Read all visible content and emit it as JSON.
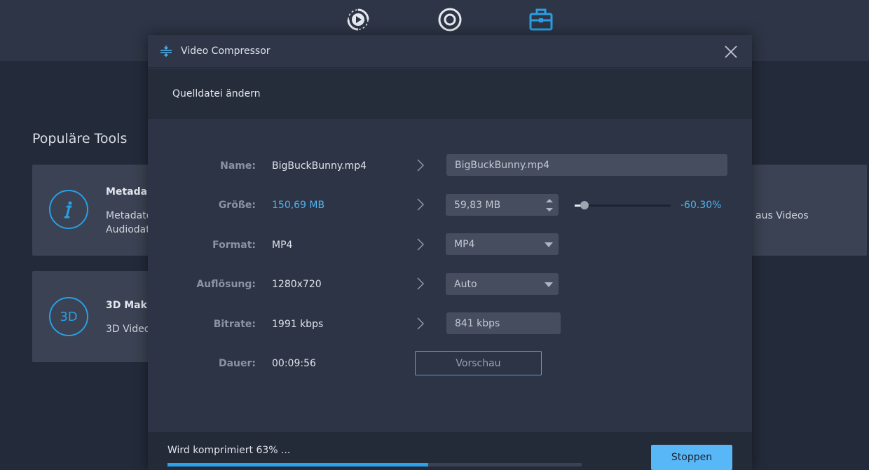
{
  "nav": {
    "items": [
      {
        "icon": "convert-icon"
      },
      {
        "icon": "disc-icon"
      },
      {
        "icon": "toolbox-icon",
        "active": true
      }
    ],
    "accent": "#2a9fe4"
  },
  "background": {
    "section_title": "Populäre Tools",
    "cards": [
      {
        "icon": "info-icon",
        "title": "Metada",
        "desc_lines": [
          "Metadate",
          "Audiodat"
        ]
      },
      {
        "icon": "3d-icon",
        "icon_text": "3D",
        "title": "3D Mak",
        "desc_lines": [
          "3D Video"
        ]
      }
    ],
    "right_card_text": "aus Videos"
  },
  "dialog": {
    "title": "Video Compressor",
    "source_link": "Quelldatei ändern",
    "rows": {
      "name": {
        "label": "Name:",
        "value": "BigBuckBunny.mp4",
        "output": "BigBuckBunny.mp4"
      },
      "size": {
        "label": "Größe:",
        "value": "150,69 MB",
        "output": "59,83 MB",
        "percent": "-60.30%",
        "slider_level": 0.03
      },
      "format": {
        "label": "Format:",
        "value": "MP4",
        "output": "MP4"
      },
      "resolution": {
        "label": "Auflösung:",
        "value": "1280x720",
        "output": "Auto"
      },
      "bitrate": {
        "label": "Bitrate:",
        "value": "1991 kbps",
        "output": "841 kbps"
      },
      "duration": {
        "label": "Dauer:",
        "value": "00:09:56"
      }
    },
    "preview_button": "Vorschau"
  },
  "footer": {
    "progress_text": "Wird komprimiert 63% ...",
    "progress": 0.63,
    "stop_button": "Stoppen"
  }
}
